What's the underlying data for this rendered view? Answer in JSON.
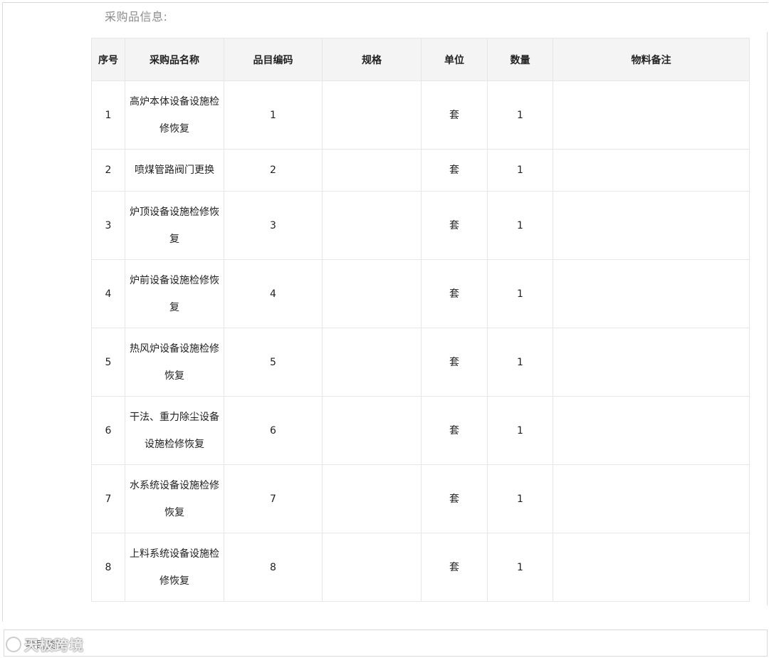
{
  "section": {
    "title": "采购品信息:"
  },
  "table": {
    "headers": [
      "序号",
      "采购品名称",
      "品目编码",
      "规格",
      "单位",
      "数量",
      "物料备注"
    ],
    "rows": [
      {
        "no": "1",
        "name": "高炉本体设备设施检修恢复",
        "code": "1",
        "spec": "",
        "unit": "套",
        "qty": "1",
        "note": ""
      },
      {
        "no": "2",
        "name": "喷煤管路阀门更换",
        "code": "2",
        "spec": "",
        "unit": "套",
        "qty": "1",
        "note": ""
      },
      {
        "no": "3",
        "name": "炉顶设备设施检修恢复",
        "code": "3",
        "spec": "",
        "unit": "套",
        "qty": "1",
        "note": ""
      },
      {
        "no": "4",
        "name": "炉前设备设施检修恢复",
        "code": "4",
        "spec": "",
        "unit": "套",
        "qty": "1",
        "note": ""
      },
      {
        "no": "5",
        "name": "热风炉设备设施检修恢复",
        "code": "5",
        "spec": "",
        "unit": "套",
        "qty": "1",
        "note": ""
      },
      {
        "no": "6",
        "name": "干法、重力除尘设备设施检修恢复",
        "code": "6",
        "spec": "",
        "unit": "套",
        "qty": "1",
        "note": ""
      },
      {
        "no": "7",
        "name": "水系统设备设施检修恢复",
        "code": "7",
        "spec": "",
        "unit": "套",
        "qty": "1",
        "note": ""
      },
      {
        "no": "8",
        "name": "上料系统设备设施检修恢复",
        "code": "8",
        "spec": "",
        "unit": "套",
        "qty": "1",
        "note": ""
      }
    ]
  },
  "footer": {
    "label": "项目类别"
  },
  "watermark": {
    "text": "天极跨境",
    "logo_icon": "swirl-logo-icon"
  }
}
